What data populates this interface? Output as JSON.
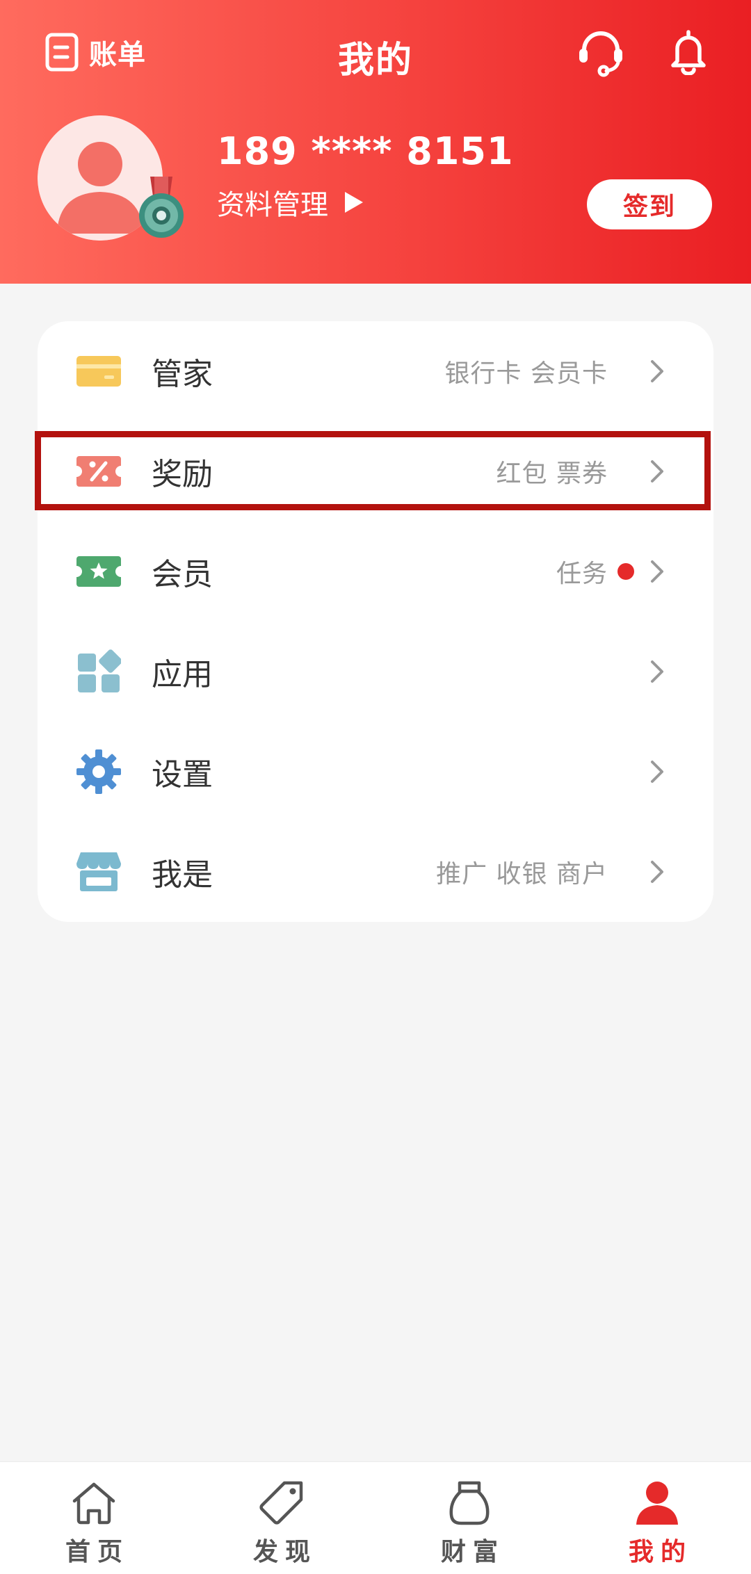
{
  "header": {
    "bill_label": "账单",
    "title": "我的",
    "support_icon": "headset-icon",
    "bell_icon": "bell-icon"
  },
  "profile": {
    "phone": "189 **** 8151",
    "manage_label": "资料管理",
    "checkin_label": "签到"
  },
  "menu": {
    "items": [
      {
        "label": "管家",
        "sub": "银行卡 会员卡",
        "icon": "card-icon",
        "color": "#f7c85a"
      },
      {
        "label": "奖励",
        "sub": "红包 票券",
        "icon": "coupon-icon",
        "color": "#f07e72"
      },
      {
        "label": "会员",
        "sub": "任务",
        "icon": "ticket-star-icon",
        "color": "#4ea86e",
        "dot": true
      },
      {
        "label": "应用",
        "sub": "",
        "icon": "apps-icon",
        "color": "#8bbfcf"
      },
      {
        "label": "设置",
        "sub": "",
        "icon": "gear-icon",
        "color": "#4f8fd3"
      },
      {
        "label": "我是",
        "sub": "推广 收银 商户",
        "icon": "store-icon",
        "color": "#7cb9cf"
      }
    ]
  },
  "nav": {
    "items": [
      {
        "label": "首页",
        "icon": "home-icon"
      },
      {
        "label": "发现",
        "icon": "tag-icon"
      },
      {
        "label": "财富",
        "icon": "money-bag-icon"
      },
      {
        "label": "我的",
        "icon": "person-icon",
        "active": true
      }
    ]
  },
  "colors": {
    "brand_red": "#e52a2a",
    "header_gradient_start": "#ff6b5e",
    "header_gradient_end": "#ea1f23",
    "highlight_border": "#b3120e"
  }
}
